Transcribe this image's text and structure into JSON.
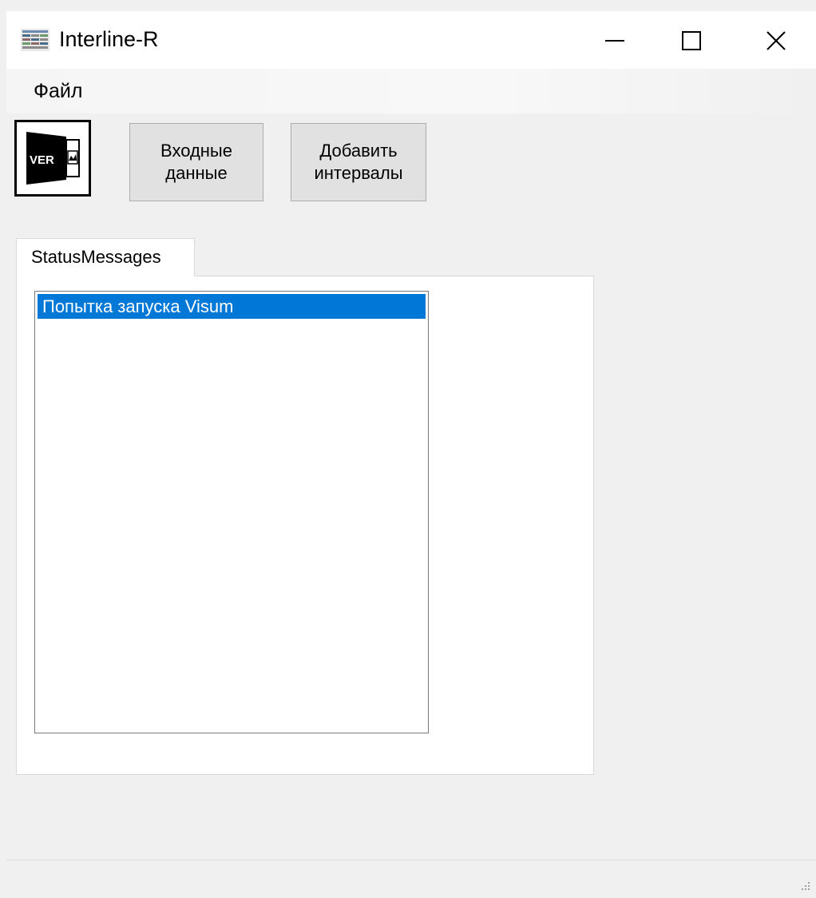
{
  "window": {
    "title": "Interline-R"
  },
  "menu": {
    "items": [
      "Файл"
    ]
  },
  "toolbar": {
    "logo_text": "VER",
    "input_data_label": "Входные\nданные",
    "add_intervals_label": "Добавить\nинтервалы"
  },
  "tabs": {
    "active_label": "StatusMessages"
  },
  "status_messages": {
    "items": [
      "Попытка запуска Visum"
    ]
  },
  "colors": {
    "selection": "#0078d7",
    "window_bg": "#f0f0f0",
    "button_bg": "#e1e1e1"
  },
  "icons": {
    "app": "app-grid-icon",
    "minimize": "minimize-icon",
    "maximize": "maximize-icon",
    "close": "close-icon",
    "logo": "ver-logo-icon",
    "grip": "resize-grip-icon"
  }
}
